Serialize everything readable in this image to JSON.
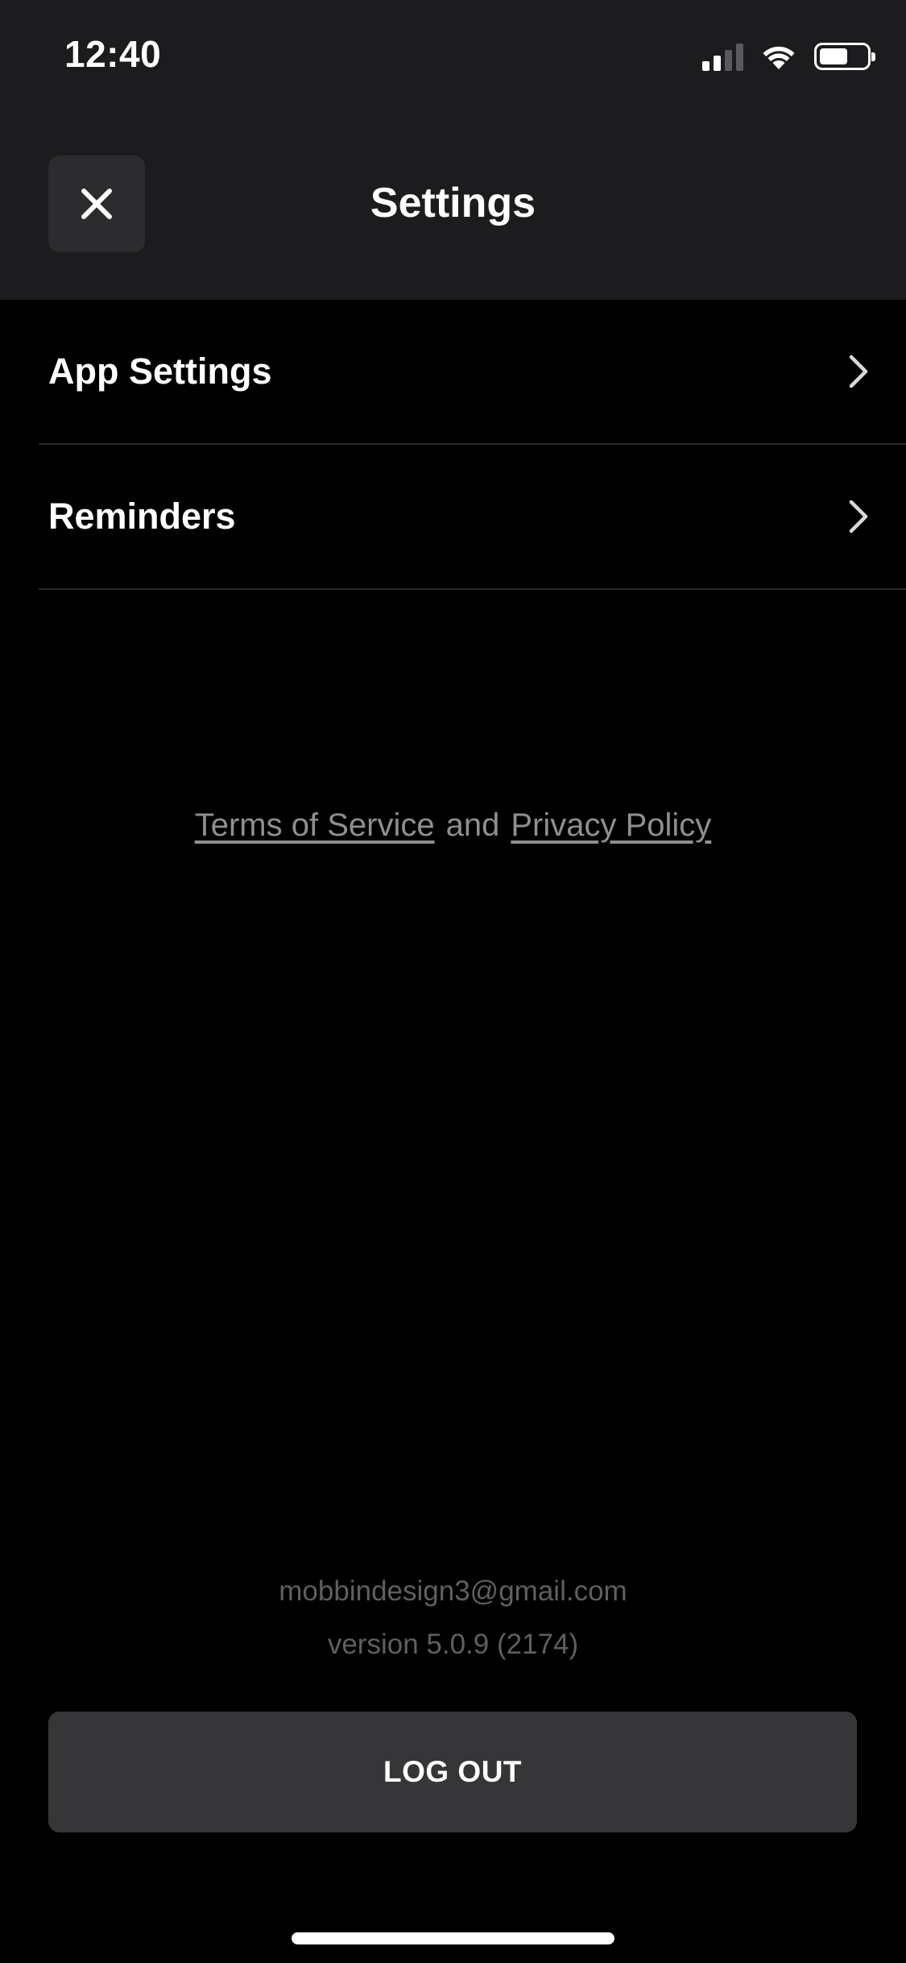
{
  "status_bar": {
    "time": "12:40",
    "signal_icon": "cellular-signal-icon",
    "wifi_icon": "wifi-icon",
    "battery_icon": "battery-icon",
    "battery_level": 0.6
  },
  "header": {
    "title": "Settings",
    "close_icon": "close-icon"
  },
  "menu": {
    "items": [
      {
        "label": "App Settings",
        "icon": "chevron-right-icon"
      },
      {
        "label": "Reminders",
        "icon": "chevron-right-icon"
      }
    ]
  },
  "legal": {
    "terms_label": "Terms of Service",
    "conjunction": "and",
    "privacy_label": "Privacy Policy"
  },
  "account": {
    "email": "mobbindesign3@gmail.com",
    "version": "version 5.0.9 (2174)"
  },
  "actions": {
    "logout_label": "LOG OUT"
  },
  "colors": {
    "background": "#000000",
    "header_background": "#1c1c1e",
    "button_background": "#363638",
    "muted_text": "#8e8e93",
    "footer_text": "#5f5f63"
  }
}
